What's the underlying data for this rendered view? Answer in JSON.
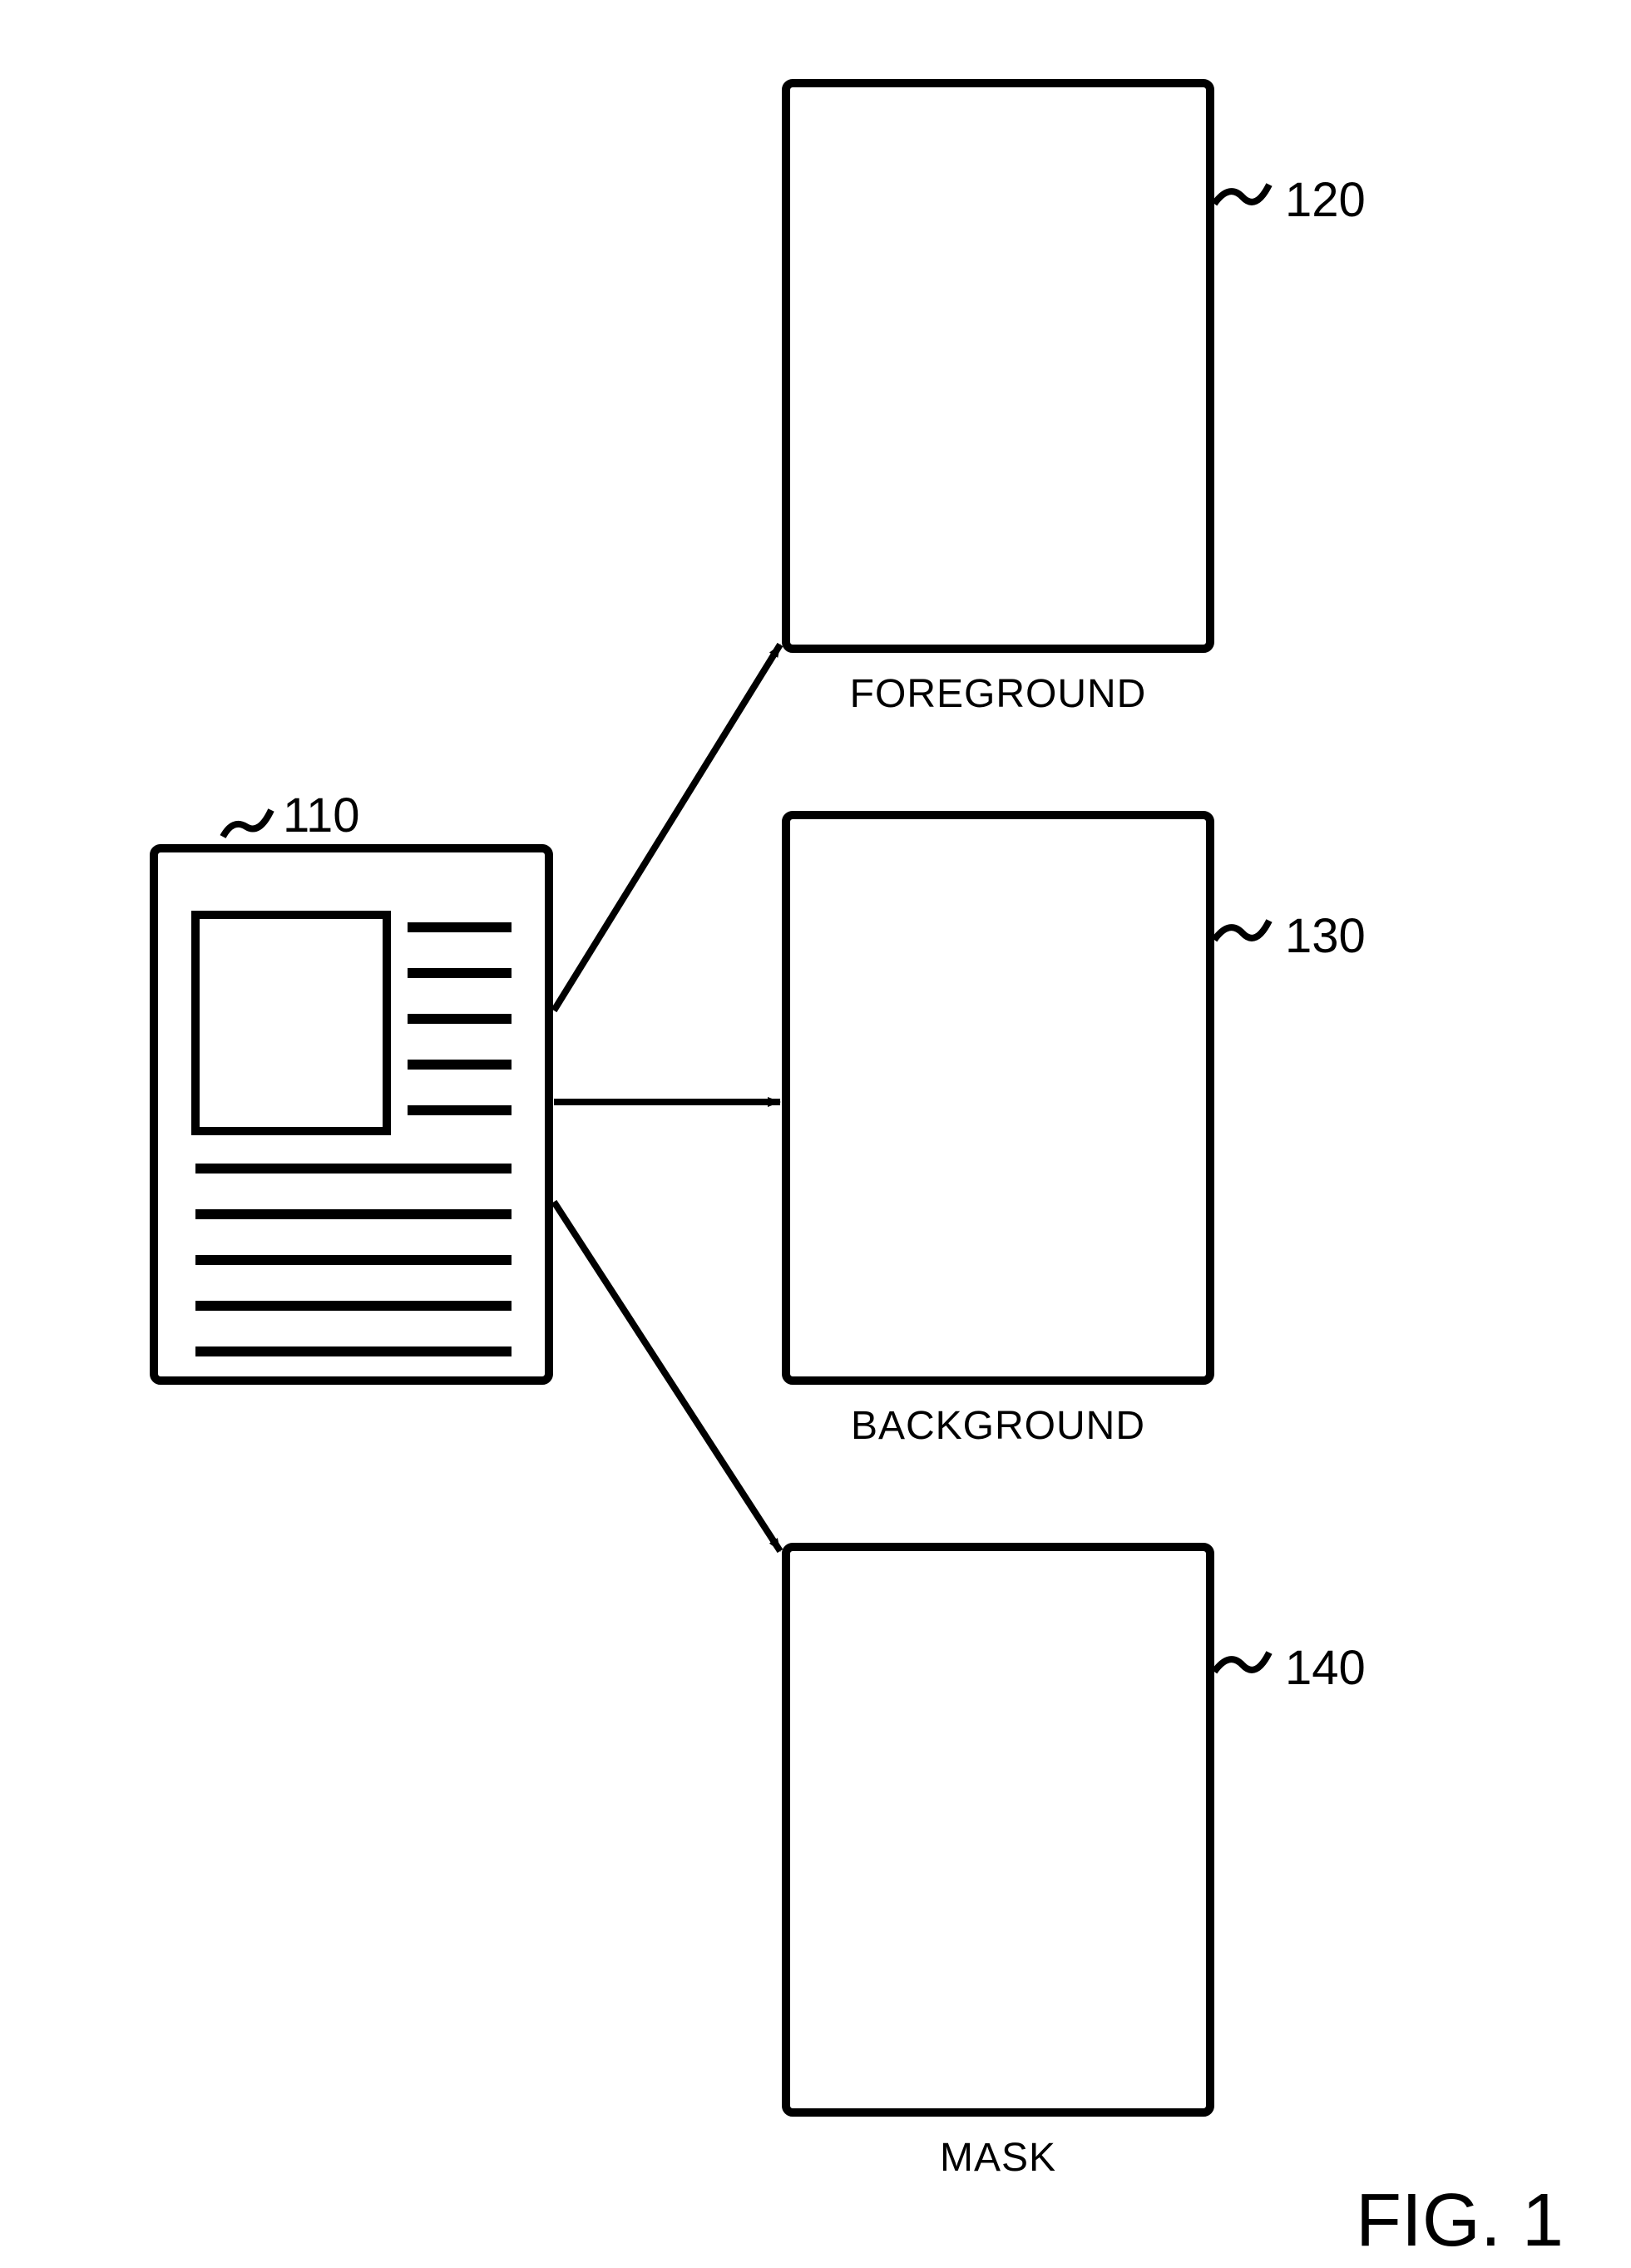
{
  "refs": {
    "source": "110",
    "foreground": "120",
    "background": "130",
    "mask": "140"
  },
  "labels": {
    "foreground": "FOREGROUND",
    "background": "BACKGROUND",
    "mask": "MASK"
  },
  "figure": "FIG. 1"
}
